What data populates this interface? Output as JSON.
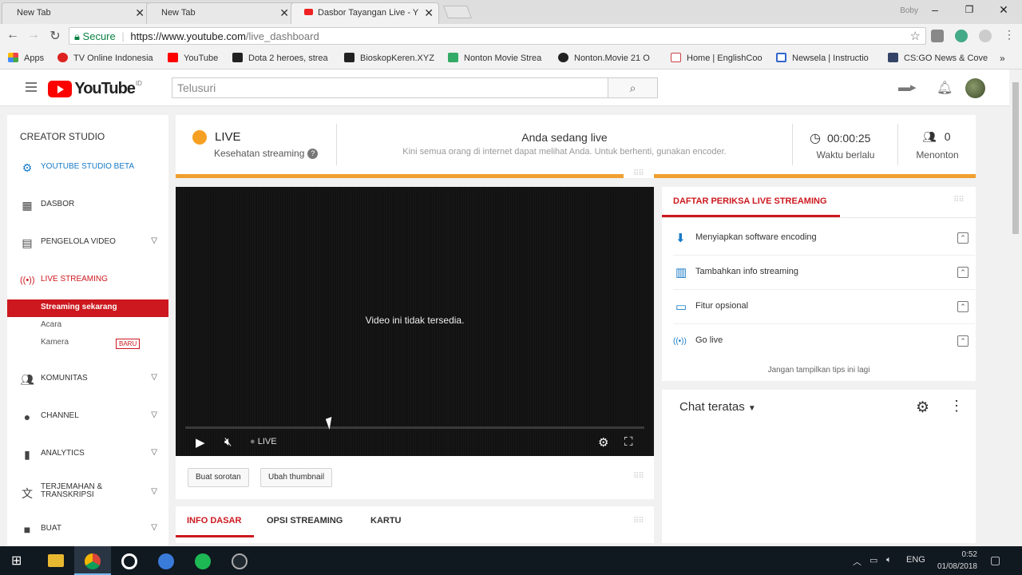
{
  "browser": {
    "tabs": [
      {
        "label": "New Tab"
      },
      {
        "label": "New Tab"
      },
      {
        "label": "Dasbor Tayangan Live - Y"
      }
    ],
    "window_user": "Boby",
    "url": {
      "secure_label": "Secure",
      "host": "https://www.youtube.com",
      "path": "/live_dashboard"
    },
    "bookmarks": [
      {
        "label": "Apps",
        "color": "#e44"
      },
      {
        "label": "TV Online Indonesia",
        "color": "#d22"
      },
      {
        "label": "YouTube",
        "color": "#f00"
      },
      {
        "label": "Dota 2 heroes, strea",
        "color": "#900"
      },
      {
        "label": "BioskopKeren.XYZ",
        "color": "#222"
      },
      {
        "label": "Nonton Movie Strea",
        "color": "#3a6"
      },
      {
        "label": "Nonton.Movie 21 O",
        "color": "#222"
      },
      {
        "label": "Home | EnglishCoo",
        "color": "#c44"
      },
      {
        "label": "Newsela | Instructio",
        "color": "#36c"
      },
      {
        "label": "CS:GO News & Cove",
        "color": "#346"
      }
    ]
  },
  "youtube": {
    "logo_text": "YouTube",
    "logo_region": "ID",
    "search_placeholder": "Telusuri"
  },
  "sidebar": {
    "title": "CREATOR STUDIO",
    "items": [
      {
        "label": "YOUTUBE STUDIO BETA",
        "icon": "gear-icon"
      },
      {
        "label": "DASBOR",
        "icon": "dashboard-icon"
      },
      {
        "label": "PENGELOLA VIDEO",
        "icon": "video-manager-icon"
      },
      {
        "label": "LIVE STREAMING",
        "icon": "live-icon"
      },
      {
        "label": "KOMUNITAS",
        "icon": "people-icon"
      },
      {
        "label": "CHANNEL",
        "icon": "account-icon"
      },
      {
        "label": "ANALYTICS",
        "icon": "bar-chart-icon"
      },
      {
        "label": "TERJEMAHAN & TRANSKRIPSI",
        "icon": "translate-icon"
      },
      {
        "label": "BUAT",
        "icon": "camera-icon"
      }
    ],
    "live_sub": [
      {
        "label": "Streaming sekarang"
      },
      {
        "label": "Acara"
      },
      {
        "label": "Kamera",
        "badge": "BARU"
      }
    ]
  },
  "status": {
    "live_label": "LIVE",
    "health_label": "Kesehatan streaming",
    "center_title": "Anda sedang live",
    "center_sub": "Kini semua orang di internet dapat melihat Anda. Untuk berhenti, gunakan encoder.",
    "elapsed": "00:00:25",
    "elapsed_label": "Waktu berlalu",
    "viewers": "0",
    "viewers_label": "Menonton"
  },
  "player": {
    "message": "Video ini tidak tersedia.",
    "live_badge": "LIVE"
  },
  "actions": {
    "highlight": "Buat sorotan",
    "thumbnail": "Ubah thumbnail"
  },
  "info_tabs": [
    {
      "label": "INFO DASAR"
    },
    {
      "label": "OPSI STREAMING"
    },
    {
      "label": "KARTU"
    }
  ],
  "checklist": {
    "title": "DAFTAR PERIKSA LIVE STREAMING",
    "items": [
      {
        "label": "Menyiapkan software encoding",
        "icon": "download-icon"
      },
      {
        "label": "Tambahkan info streaming",
        "icon": "chart-icon"
      },
      {
        "label": "Fitur opsional",
        "icon": "card-icon"
      },
      {
        "label": "Go live",
        "icon": "live-icon"
      }
    ],
    "footer": "Jangan tampilkan tips ini lagi"
  },
  "chat": {
    "title": "Chat teratas"
  },
  "taskbar": {
    "lang": "ENG",
    "time": "0:52",
    "date": "01/08/2018"
  }
}
